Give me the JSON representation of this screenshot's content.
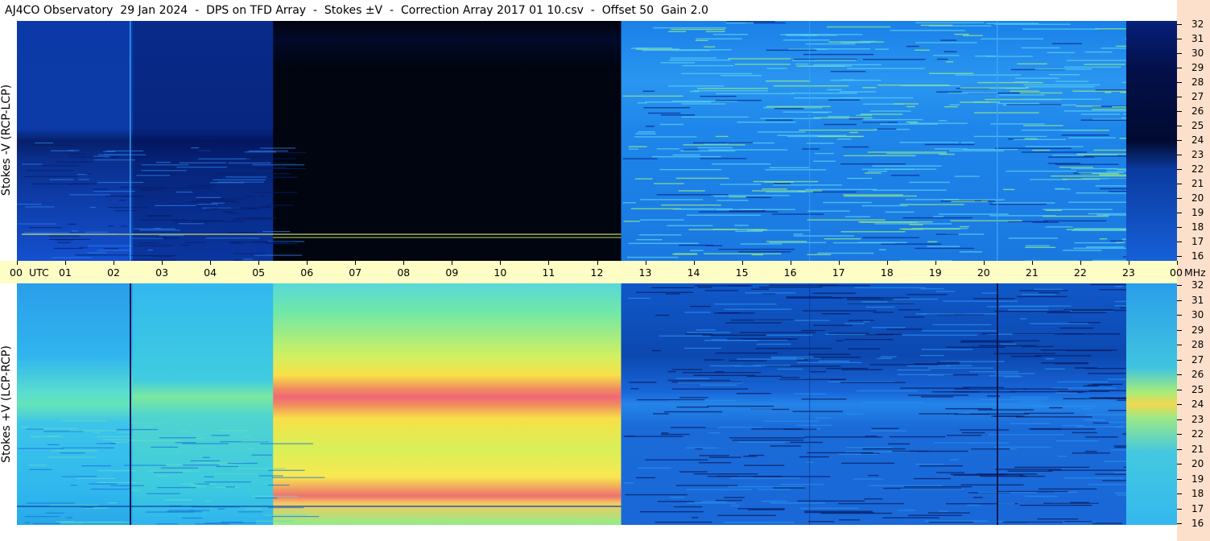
{
  "title": "AJ4CO Observatory  29 Jan 2024  -  DPS on TFD Array  -  Stokes ±V  -  Correction Array 2017 01 10.csv  -  Offset 50  Gain 2.0",
  "chart_data": {
    "type": "heatmap",
    "title": "AJ4CO Observatory  29 Jan 2024  -  DPS on TFD Array  -  Stokes ±V  -  Correction Array 2017 01 10.csv  -  Offset 50  Gain 2.0",
    "x_axis": {
      "labels": [
        "00",
        "01",
        "02",
        "03",
        "04",
        "05",
        "06",
        "07",
        "08",
        "09",
        "10",
        "11",
        "12",
        "13",
        "14",
        "15",
        "16",
        "17",
        "18",
        "19",
        "20",
        "21",
        "22",
        "23",
        "00"
      ],
      "unit": "UTC",
      "range": [
        0,
        24
      ]
    },
    "y_axis": {
      "ticks": [
        16,
        17,
        18,
        19,
        20,
        21,
        22,
        23,
        24,
        25,
        26,
        27,
        28,
        29,
        30,
        31,
        32
      ],
      "unit": "MHz",
      "range": [
        16,
        32
      ]
    },
    "panels": [
      {
        "name": "Stokes -V (RCP-LCP)",
        "baseline": "blue",
        "segments": [
          {
            "from": 0.0,
            "to": 2.4,
            "fill": "blue"
          },
          {
            "from": 2.4,
            "to": 5.3,
            "fill": "dark-blue"
          },
          {
            "from": 5.3,
            "to": 12.5,
            "fill": "black"
          },
          {
            "from": 12.5,
            "to": 22.95,
            "fill": "bright-blue-rfi"
          },
          {
            "from": 22.95,
            "to": 24.0,
            "fill": "dark-blue"
          }
        ]
      },
      {
        "name": "Stokes +V (LCP-RCP)",
        "baseline": "cyan",
        "segments": [
          {
            "from": 0.0,
            "to": 2.4,
            "fill": "cyan"
          },
          {
            "from": 2.4,
            "to": 5.3,
            "fill": "cyan-green"
          },
          {
            "from": 5.3,
            "to": 12.5,
            "fill": "yellow-red"
          },
          {
            "from": 12.5,
            "to": 22.95,
            "fill": "blue-rfi"
          },
          {
            "from": 22.95,
            "to": 24.0,
            "fill": "cyan-yellow"
          }
        ]
      }
    ],
    "colors": {
      "background": "#ffffff",
      "time_strip": "#fffdc6",
      "freq_strip": "#fde0cb",
      "black": "#000814",
      "dark_blue": "#06207a",
      "blue": "#1048c8",
      "bright_blue": "#1a8af0",
      "cyan": "#32c8f0",
      "green": "#78e6a0",
      "yellow": "#f8f040",
      "red": "#f06070"
    }
  },
  "time_axis_unit": "UTC",
  "freq_unit": "MHz"
}
